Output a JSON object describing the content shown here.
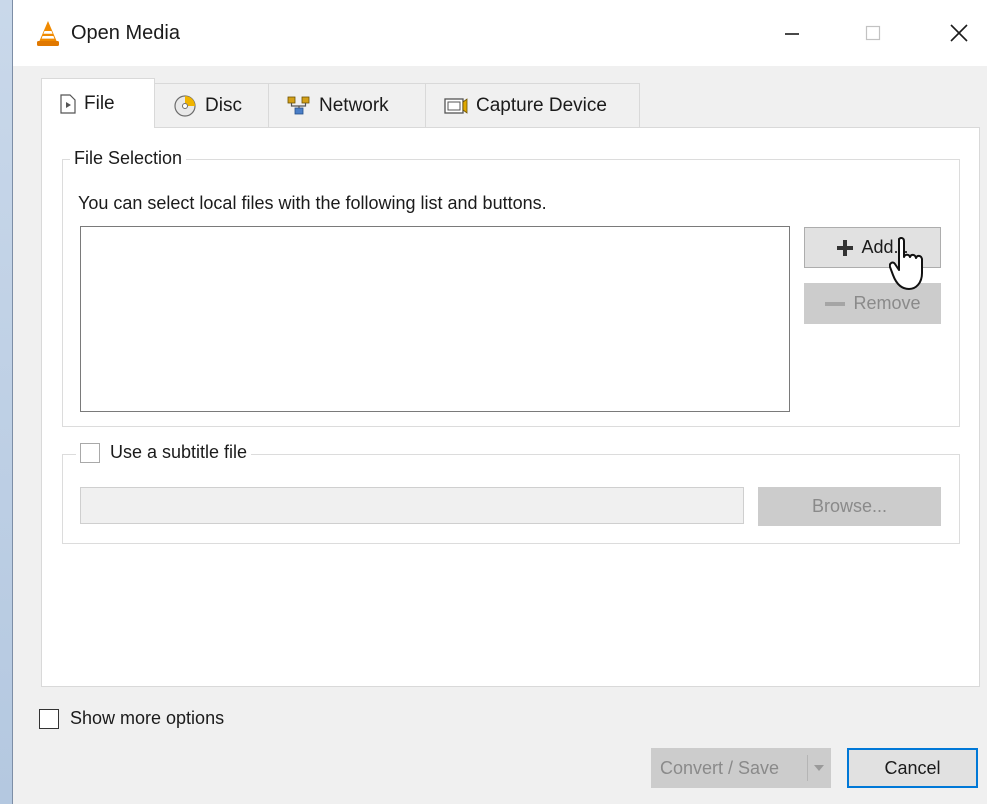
{
  "window": {
    "title": "Open Media",
    "app_icon": "vlc-cone-icon",
    "controls": [
      "minimize-icon",
      "maximize-icon",
      "close-icon"
    ]
  },
  "tabs": [
    {
      "label": "File",
      "icon": "file-play-icon",
      "selected": true
    },
    {
      "label": "Disc",
      "icon": "disc-icon",
      "selected": false
    },
    {
      "label": "Network",
      "icon": "network-icon",
      "selected": false
    },
    {
      "label": "Capture Device",
      "icon": "capture-device-icon",
      "selected": false
    }
  ],
  "file_selection": {
    "legend": "File Selection",
    "hint": "You can select local files with the following list and buttons.",
    "files": [],
    "add_label": "Add...",
    "remove_label": "Remove"
  },
  "subtitle": {
    "label": "Use a subtitle file",
    "checked": false,
    "path_value": "",
    "browse_label": "Browse..."
  },
  "footer": {
    "show_more_label": "Show more options",
    "show_more_checked": false,
    "convert_label": "Convert / Save",
    "cancel_label": "Cancel"
  },
  "colors": {
    "accent": "#0078d7",
    "vlc_orange": "#f08a00",
    "disabled_bg": "#cccccc",
    "disabled_text": "#8a8a8a"
  }
}
